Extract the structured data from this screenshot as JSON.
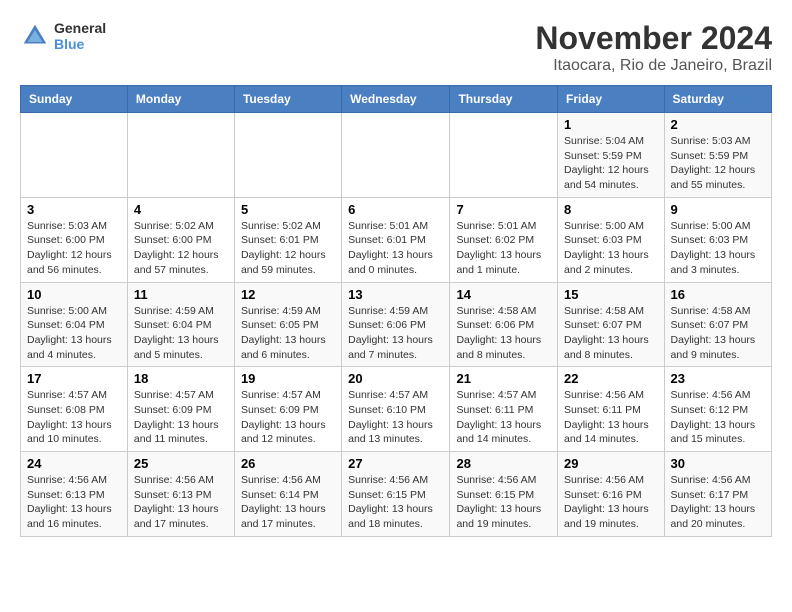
{
  "header": {
    "logo_line1": "General",
    "logo_line2": "Blue",
    "title": "November 2024",
    "subtitle": "Itaocara, Rio de Janeiro, Brazil"
  },
  "weekdays": [
    "Sunday",
    "Monday",
    "Tuesday",
    "Wednesday",
    "Thursday",
    "Friday",
    "Saturday"
  ],
  "weeks": [
    [
      {
        "day": "",
        "info": ""
      },
      {
        "day": "",
        "info": ""
      },
      {
        "day": "",
        "info": ""
      },
      {
        "day": "",
        "info": ""
      },
      {
        "day": "",
        "info": ""
      },
      {
        "day": "1",
        "info": "Sunrise: 5:04 AM\nSunset: 5:59 PM\nDaylight: 12 hours and 54 minutes."
      },
      {
        "day": "2",
        "info": "Sunrise: 5:03 AM\nSunset: 5:59 PM\nDaylight: 12 hours and 55 minutes."
      }
    ],
    [
      {
        "day": "3",
        "info": "Sunrise: 5:03 AM\nSunset: 6:00 PM\nDaylight: 12 hours and 56 minutes."
      },
      {
        "day": "4",
        "info": "Sunrise: 5:02 AM\nSunset: 6:00 PM\nDaylight: 12 hours and 57 minutes."
      },
      {
        "day": "5",
        "info": "Sunrise: 5:02 AM\nSunset: 6:01 PM\nDaylight: 12 hours and 59 minutes."
      },
      {
        "day": "6",
        "info": "Sunrise: 5:01 AM\nSunset: 6:01 PM\nDaylight: 13 hours and 0 minutes."
      },
      {
        "day": "7",
        "info": "Sunrise: 5:01 AM\nSunset: 6:02 PM\nDaylight: 13 hours and 1 minute."
      },
      {
        "day": "8",
        "info": "Sunrise: 5:00 AM\nSunset: 6:03 PM\nDaylight: 13 hours and 2 minutes."
      },
      {
        "day": "9",
        "info": "Sunrise: 5:00 AM\nSunset: 6:03 PM\nDaylight: 13 hours and 3 minutes."
      }
    ],
    [
      {
        "day": "10",
        "info": "Sunrise: 5:00 AM\nSunset: 6:04 PM\nDaylight: 13 hours and 4 minutes."
      },
      {
        "day": "11",
        "info": "Sunrise: 4:59 AM\nSunset: 6:04 PM\nDaylight: 13 hours and 5 minutes."
      },
      {
        "day": "12",
        "info": "Sunrise: 4:59 AM\nSunset: 6:05 PM\nDaylight: 13 hours and 6 minutes."
      },
      {
        "day": "13",
        "info": "Sunrise: 4:59 AM\nSunset: 6:06 PM\nDaylight: 13 hours and 7 minutes."
      },
      {
        "day": "14",
        "info": "Sunrise: 4:58 AM\nSunset: 6:06 PM\nDaylight: 13 hours and 8 minutes."
      },
      {
        "day": "15",
        "info": "Sunrise: 4:58 AM\nSunset: 6:07 PM\nDaylight: 13 hours and 8 minutes."
      },
      {
        "day": "16",
        "info": "Sunrise: 4:58 AM\nSunset: 6:07 PM\nDaylight: 13 hours and 9 minutes."
      }
    ],
    [
      {
        "day": "17",
        "info": "Sunrise: 4:57 AM\nSunset: 6:08 PM\nDaylight: 13 hours and 10 minutes."
      },
      {
        "day": "18",
        "info": "Sunrise: 4:57 AM\nSunset: 6:09 PM\nDaylight: 13 hours and 11 minutes."
      },
      {
        "day": "19",
        "info": "Sunrise: 4:57 AM\nSunset: 6:09 PM\nDaylight: 13 hours and 12 minutes."
      },
      {
        "day": "20",
        "info": "Sunrise: 4:57 AM\nSunset: 6:10 PM\nDaylight: 13 hours and 13 minutes."
      },
      {
        "day": "21",
        "info": "Sunrise: 4:57 AM\nSunset: 6:11 PM\nDaylight: 13 hours and 14 minutes."
      },
      {
        "day": "22",
        "info": "Sunrise: 4:56 AM\nSunset: 6:11 PM\nDaylight: 13 hours and 14 minutes."
      },
      {
        "day": "23",
        "info": "Sunrise: 4:56 AM\nSunset: 6:12 PM\nDaylight: 13 hours and 15 minutes."
      }
    ],
    [
      {
        "day": "24",
        "info": "Sunrise: 4:56 AM\nSunset: 6:13 PM\nDaylight: 13 hours and 16 minutes."
      },
      {
        "day": "25",
        "info": "Sunrise: 4:56 AM\nSunset: 6:13 PM\nDaylight: 13 hours and 17 minutes."
      },
      {
        "day": "26",
        "info": "Sunrise: 4:56 AM\nSunset: 6:14 PM\nDaylight: 13 hours and 17 minutes."
      },
      {
        "day": "27",
        "info": "Sunrise: 4:56 AM\nSunset: 6:15 PM\nDaylight: 13 hours and 18 minutes."
      },
      {
        "day": "28",
        "info": "Sunrise: 4:56 AM\nSunset: 6:15 PM\nDaylight: 13 hours and 19 minutes."
      },
      {
        "day": "29",
        "info": "Sunrise: 4:56 AM\nSunset: 6:16 PM\nDaylight: 13 hours and 19 minutes."
      },
      {
        "day": "30",
        "info": "Sunrise: 4:56 AM\nSunset: 6:17 PM\nDaylight: 13 hours and 20 minutes."
      }
    ]
  ]
}
